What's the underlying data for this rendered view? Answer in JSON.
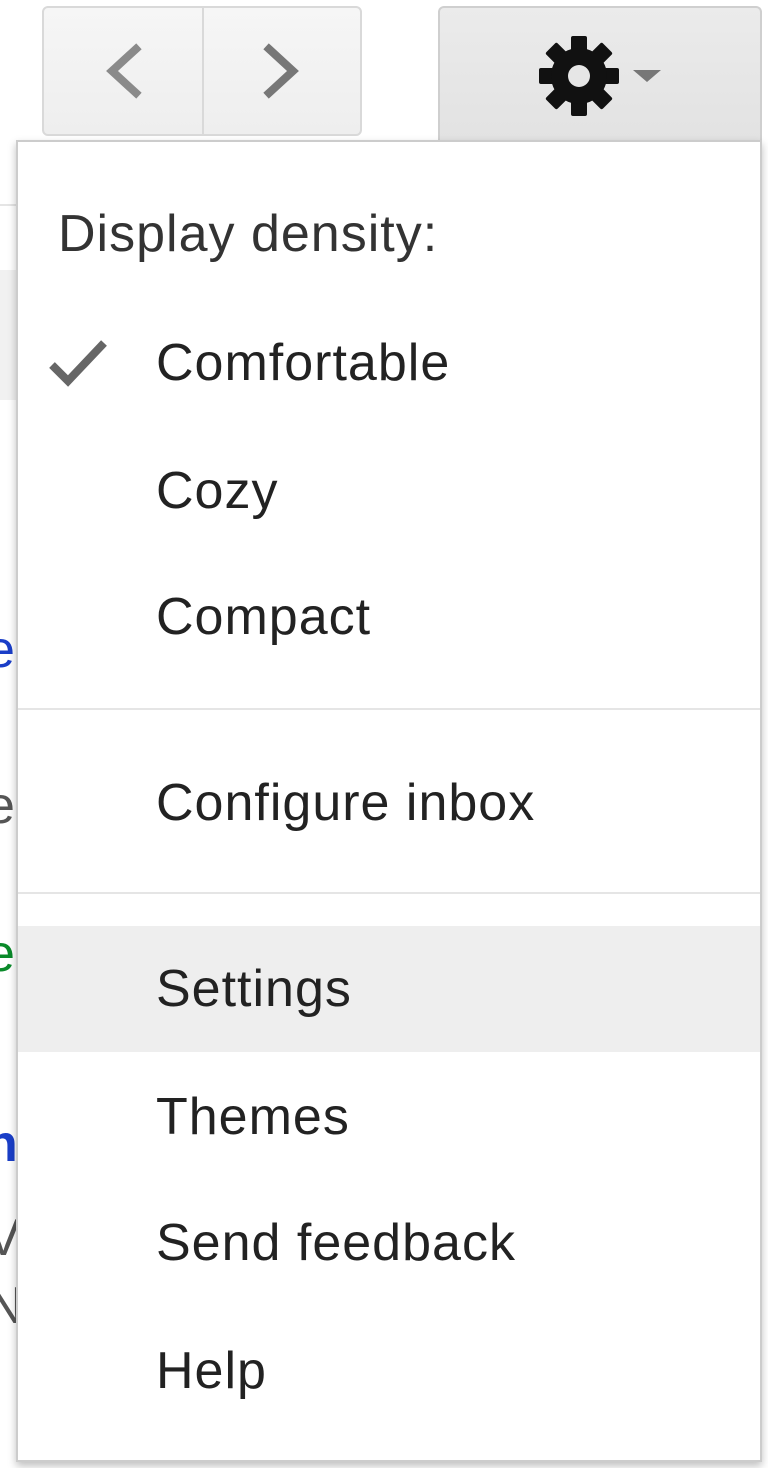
{
  "toolbar": {
    "prev_icon": "chevron-left-icon",
    "next_icon": "chevron-right-icon",
    "settings_icon": "gear-icon",
    "dropdown_icon": "caret-down-icon"
  },
  "menu": {
    "heading": "Display density:",
    "density_options": [
      {
        "label": "Comfortable",
        "selected": true
      },
      {
        "label": "Cozy",
        "selected": false
      },
      {
        "label": "Compact",
        "selected": false
      }
    ],
    "configure_inbox": "Configure inbox",
    "items": [
      {
        "label": "Settings",
        "highlighted": true
      },
      {
        "label": "Themes",
        "highlighted": false
      },
      {
        "label": "Send feedback",
        "highlighted": false
      },
      {
        "label": "Help",
        "highlighted": false
      }
    ],
    "check_icon": "checkmark-icon"
  },
  "background": {
    "fragments": [
      "e",
      "e",
      "e",
      "n",
      "V",
      "N"
    ]
  },
  "colors": {
    "highlight": "#eeeeee",
    "border": "#cccccc",
    "icon_gray": "#777777",
    "gear": "#111111",
    "link_blue": "#1a3ec8",
    "green": "#0a8a2a"
  }
}
